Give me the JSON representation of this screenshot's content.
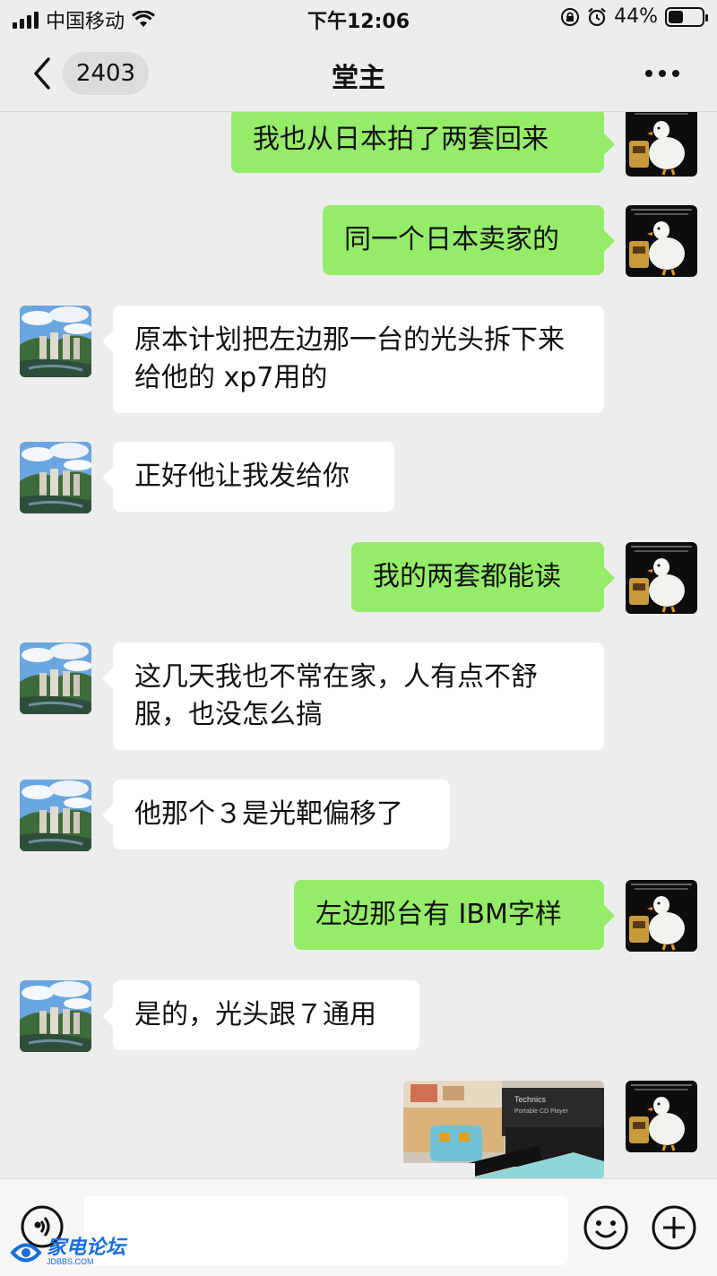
{
  "status_bar": {
    "carrier": "中国移动",
    "time": "下午12:06",
    "battery_percent": "44%",
    "battery_level": 0.44
  },
  "nav": {
    "unread_count": "2403",
    "title": "堂主",
    "back_icon": "chevron-left-icon",
    "more_icon": "more-dots-icon"
  },
  "messages": [
    {
      "side": "out",
      "text": "我也从日本拍了两套回来"
    },
    {
      "side": "out",
      "text": "同一个日本卖家的"
    },
    {
      "side": "in",
      "text": "原本计划把左边那一台的光头拆下来给他的 xp7用的"
    },
    {
      "side": "in",
      "text": "正好他让我发给你"
    },
    {
      "side": "out",
      "text": "我的两套都能读"
    },
    {
      "side": "in",
      "text": "这几天我也不常在家，人有点不舒服，也没怎么搞"
    },
    {
      "side": "in",
      "text": "他那个３是光靶偏移了"
    },
    {
      "side": "out",
      "text": "左边那台有 IBM字样"
    },
    {
      "side": "in",
      "text": "是的，光头跟７通用"
    },
    {
      "side": "out",
      "type": "image",
      "text": ""
    }
  ],
  "photo_labels": {
    "brand": "Technics",
    "subtitle": "Portable CD Player"
  },
  "input_bar": {
    "voice_icon": "voice-icon",
    "emoji_icon": "emoji-icon",
    "plus_icon": "plus-circle-icon"
  },
  "watermark": {
    "text": "家电论坛",
    "sub": "JDBBS.COM"
  },
  "colors": {
    "outgoing_bubble": "#95ec69",
    "incoming_bubble": "#ffffff",
    "background": "#ededed"
  }
}
